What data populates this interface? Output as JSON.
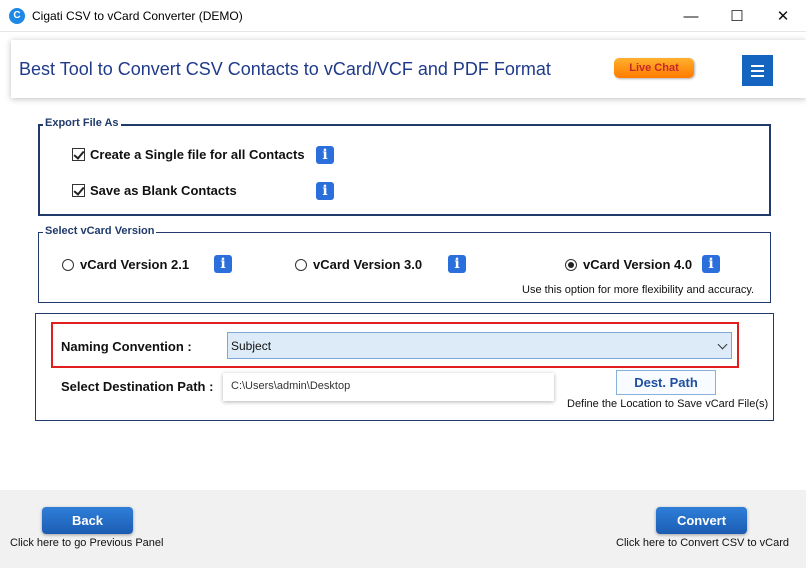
{
  "window": {
    "icon_letter": "C",
    "title": "Cigati CSV to vCard Converter (DEMO)",
    "minimize_glyph": "—",
    "maximize_glyph": "☐",
    "close_glyph": "✕"
  },
  "header": {
    "title": "Best Tool to Convert CSV Contacts to vCard/VCF and PDF Format",
    "live_chat": "Live Chat",
    "menu_icon": "hamburger-icon"
  },
  "export": {
    "legend": "Export File As",
    "options": [
      {
        "label": "Create a Single file for all Contacts",
        "checked": true
      },
      {
        "label": "Save as Blank Contacts",
        "checked": true
      }
    ]
  },
  "version": {
    "legend": "Select vCard Version",
    "options": [
      {
        "label": "vCard Version 2.1",
        "selected": false
      },
      {
        "label": "vCard Version 3.0",
        "selected": false
      },
      {
        "label": "vCard Version 4.0",
        "selected": true
      }
    ],
    "hint": "Use this option for more flexibility and accuracy."
  },
  "naming": {
    "label": "Naming Convention :",
    "selected": "Subject"
  },
  "destination": {
    "label": "Select Destination Path :",
    "path": "C:\\Users\\admin\\Desktop",
    "button": "Dest. Path",
    "hint": "Define the Location to Save vCard File(s)"
  },
  "footer": {
    "back_label": "Back",
    "back_caption": "Click here to go Previous Panel",
    "convert_label": "Convert",
    "convert_caption": "Click here to Convert CSV to vCard"
  },
  "colors": {
    "accent": "#1565c0",
    "header_title": "#1f3a8a",
    "highlight_border": "#e11d1d",
    "live_chat": "#ff7a00"
  }
}
